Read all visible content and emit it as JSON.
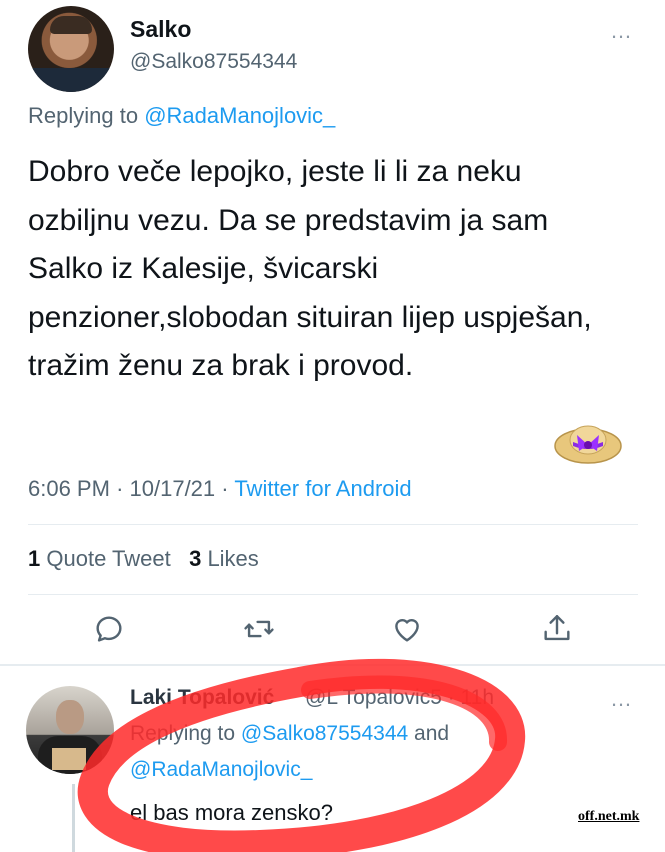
{
  "tweet": {
    "author_name": "Salko",
    "author_handle": "@Salko87554344",
    "more_icon": "…",
    "replying_prefix": "Replying to",
    "replying_to": "@RadaManojlovic_",
    "text": "Dobro veče lepojko, jeste li li za neku ozbiljnu vezu. Da se predstavim ja sam Salko iz Kalesije, švicarski penzioner,slobodan situiran lijep uspješan, tražim ženu za brak i provod.",
    "time": "6:06 PM",
    "date": "10/17/21",
    "source": "Twitter for Android",
    "quote_count": "1",
    "quote_label": "Quote Tweet",
    "like_count": "3",
    "like_label": "Likes"
  },
  "actions": {
    "reply_icon": "reply-icon",
    "retweet_icon": "retweet-icon",
    "like_icon": "heart-icon",
    "share_icon": "share-icon"
  },
  "reply": {
    "author_name": "Laki Topalović",
    "author_handle": "@L   Topalovic5 · 11h",
    "more_icon": "…",
    "replying_prefix": "Replying to",
    "replying_to_1": "@Salko87554344",
    "and_text": "and",
    "replying_to_2": "@RadaManojlovic_",
    "text": "el bas mora zensko?"
  },
  "watermark": "off.net.mk",
  "colors": {
    "link": "#1d9bf0",
    "muted": "#536471",
    "scribble": "#ff2a2a"
  }
}
